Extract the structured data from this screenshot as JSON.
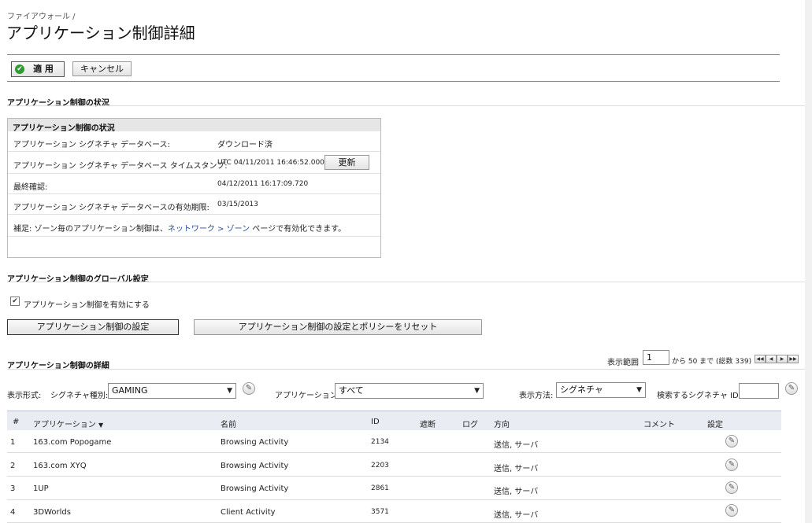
{
  "breadcrumb": "ファイアウォール /",
  "page_title": "アプリケーション制御詳細",
  "toolbar": {
    "apply_label": "適 用",
    "cancel_label": "キャンセル"
  },
  "status_section": {
    "title": "アプリケーション制御の状況",
    "box_title": "アプリケーション制御の状況",
    "rows": [
      {
        "label": "アプリケーション シグネチャ データベース:",
        "value": "ダウンロード済"
      },
      {
        "label": "アプリケーション シグネチャ データベース タイムスタンプ:",
        "value": "UTC 04/11/2011 16:46:52.000"
      },
      {
        "label": "最終確認:",
        "value": "04/12/2011 16:17:09.720"
      },
      {
        "label": "アプリケーション シグネチャ データベースの有効期限:",
        "value": "03/15/2013"
      }
    ],
    "refresh_label": "更新",
    "note_prefix": "補足:",
    "note_text_1": " ゾーン毎のアプリケーション制御は、",
    "note_link": "ネットワーク > ゾーン",
    "note_text_2": " ページで有効化できます。"
  },
  "global_section": {
    "title": "アプリケーション制御のグローバル設定",
    "enable_label": "アプリケーション制御を有効にする",
    "enable_checked": true,
    "settings_button": "アプリケーション制御の設定",
    "reset_button": "アプリケーション制御の設定とポリシーをリセット"
  },
  "details_section": {
    "title": "アプリケーション制御の詳細",
    "range_label": "表示範囲",
    "range_value": "1",
    "range_suffix": "から 50 まで (総数 339)",
    "display_format_label": "表示形式:",
    "sig_category_label": "シグネチャ種別:",
    "sig_category_value": "GAMING",
    "application_label": "アプリケーション:",
    "application_value": "すべて",
    "view_method_label": "表示方法:",
    "view_method_value": "シグネチャ",
    "search_id_label": "検索するシグネチャ ID:",
    "search_id_value": ""
  },
  "table": {
    "headers": [
      "#",
      "アプリケーション",
      "名前",
      "ID",
      "遮断",
      "ログ",
      "方向",
      "コメント",
      "設定"
    ],
    "sort_indicator": "▼",
    "rows": [
      {
        "num": "1",
        "app": "163.com Popogame",
        "name": "Browsing Activity",
        "id": "2134",
        "dir": "送信, サーバ"
      },
      {
        "num": "2",
        "app": "163.com XYQ",
        "name": "Browsing Activity",
        "id": "2203",
        "dir": "送信, サーバ"
      },
      {
        "num": "3",
        "app": "1UP",
        "name": "Browsing Activity",
        "id": "2861",
        "dir": "送信, サーバ"
      },
      {
        "num": "4",
        "app": "3DWorlds",
        "name": "Client Activity",
        "id": "3571",
        "dir": "送信, サーバ"
      }
    ]
  },
  "icons": {
    "apply": "check-circle-icon",
    "edit": "pencil-icon",
    "pager": [
      "first-page-icon",
      "prev-page-icon",
      "next-page-icon",
      "last-page-icon"
    ]
  }
}
